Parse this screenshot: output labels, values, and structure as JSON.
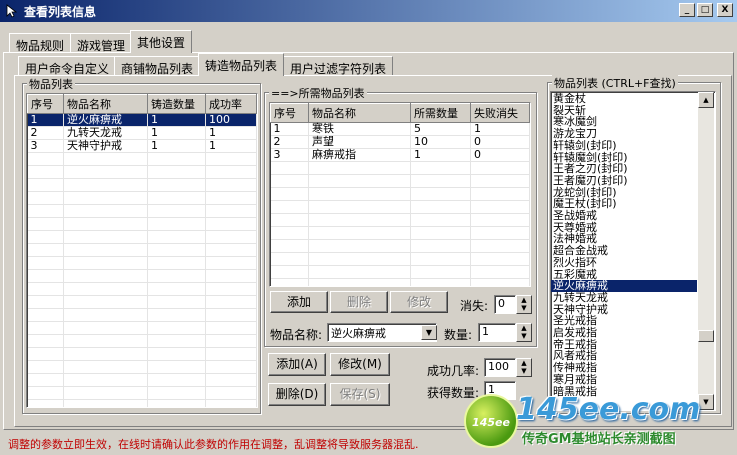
{
  "window": {
    "title": "查看列表信息",
    "btn_min": "_",
    "btn_max": "□",
    "btn_close": "X"
  },
  "tabs_top": [
    "物品规则",
    "游戏管理",
    "其他设置"
  ],
  "tabs_sub": [
    "用户命令自定义",
    "商铺物品列表",
    "铸造物品列表",
    "用户过滤字符列表"
  ],
  "left_group": {
    "title": "物品列表",
    "headers": [
      "序号",
      "物品名称",
      "铸造数量",
      "成功率"
    ],
    "rows": [
      [
        "1",
        "逆火麻痹戒",
        "1",
        "100"
      ],
      [
        "2",
        "九转天龙戒",
        "1",
        "1"
      ],
      [
        "3",
        "天神守护戒",
        "1",
        "1"
      ]
    ]
  },
  "mid_group": {
    "title": "==>所需物品列表",
    "headers": [
      "序号",
      "物品名称",
      "所需数量",
      "失败消失"
    ],
    "rows": [
      [
        "1",
        "寒铁",
        "5",
        "1"
      ],
      [
        "2",
        "声望",
        "10",
        "0"
      ],
      [
        "3",
        "麻痹戒指",
        "1",
        "0"
      ]
    ],
    "btn_add": "添加",
    "btn_delete": "删除",
    "btn_modify": "修改",
    "lbl_disappear": "消失:",
    "val_disappear": "0",
    "lbl_item_name": "物品名称:",
    "val_item_name": "逆火麻痹戒",
    "lbl_quantity": "数量:",
    "val_quantity": "1"
  },
  "bottom_controls": {
    "btn_add": "添加(A)",
    "btn_modify": "修改(M)",
    "btn_delete": "删除(D)",
    "btn_save": "保存(S)",
    "lbl_success_rate": "成功几率:",
    "val_success_rate": "100",
    "lbl_get_quantity": "获得数量:",
    "val_get_quantity": "1"
  },
  "right_group": {
    "title": "物品列表 (CTRL+F查找)",
    "items": [
      "黄金杖",
      "裂天斩",
      "寒冰魔剑",
      "游龙宝刀",
      "轩辕剑(封印)",
      "轩辕魔剑(封印)",
      "王者之刃(封印)",
      "王者魔刃(封印)",
      "龙蛇剑(封印)",
      "魔王杖(封印)",
      "圣战婚戒",
      "天尊婚戒",
      "法神婚戒",
      "超合金战戒",
      "烈火指环",
      "五彩魔戒",
      "逆火麻痹戒",
      "九转天龙戒",
      "天神守护戒",
      "圣光戒指",
      "启发戒指",
      "帝王戒指",
      "风者戒指",
      "传神戒指",
      "寒月戒指",
      "暗黑戒指"
    ],
    "selected_index": 16
  },
  "status": "调整的参数立即生效，在线时请确认此参数的作用在调整，乱调整将导致服务器混乱.",
  "watermark": {
    "circle": "145ee",
    "brand": "145ee.com",
    "sub": "传奇GM基地站长亲测截图"
  }
}
